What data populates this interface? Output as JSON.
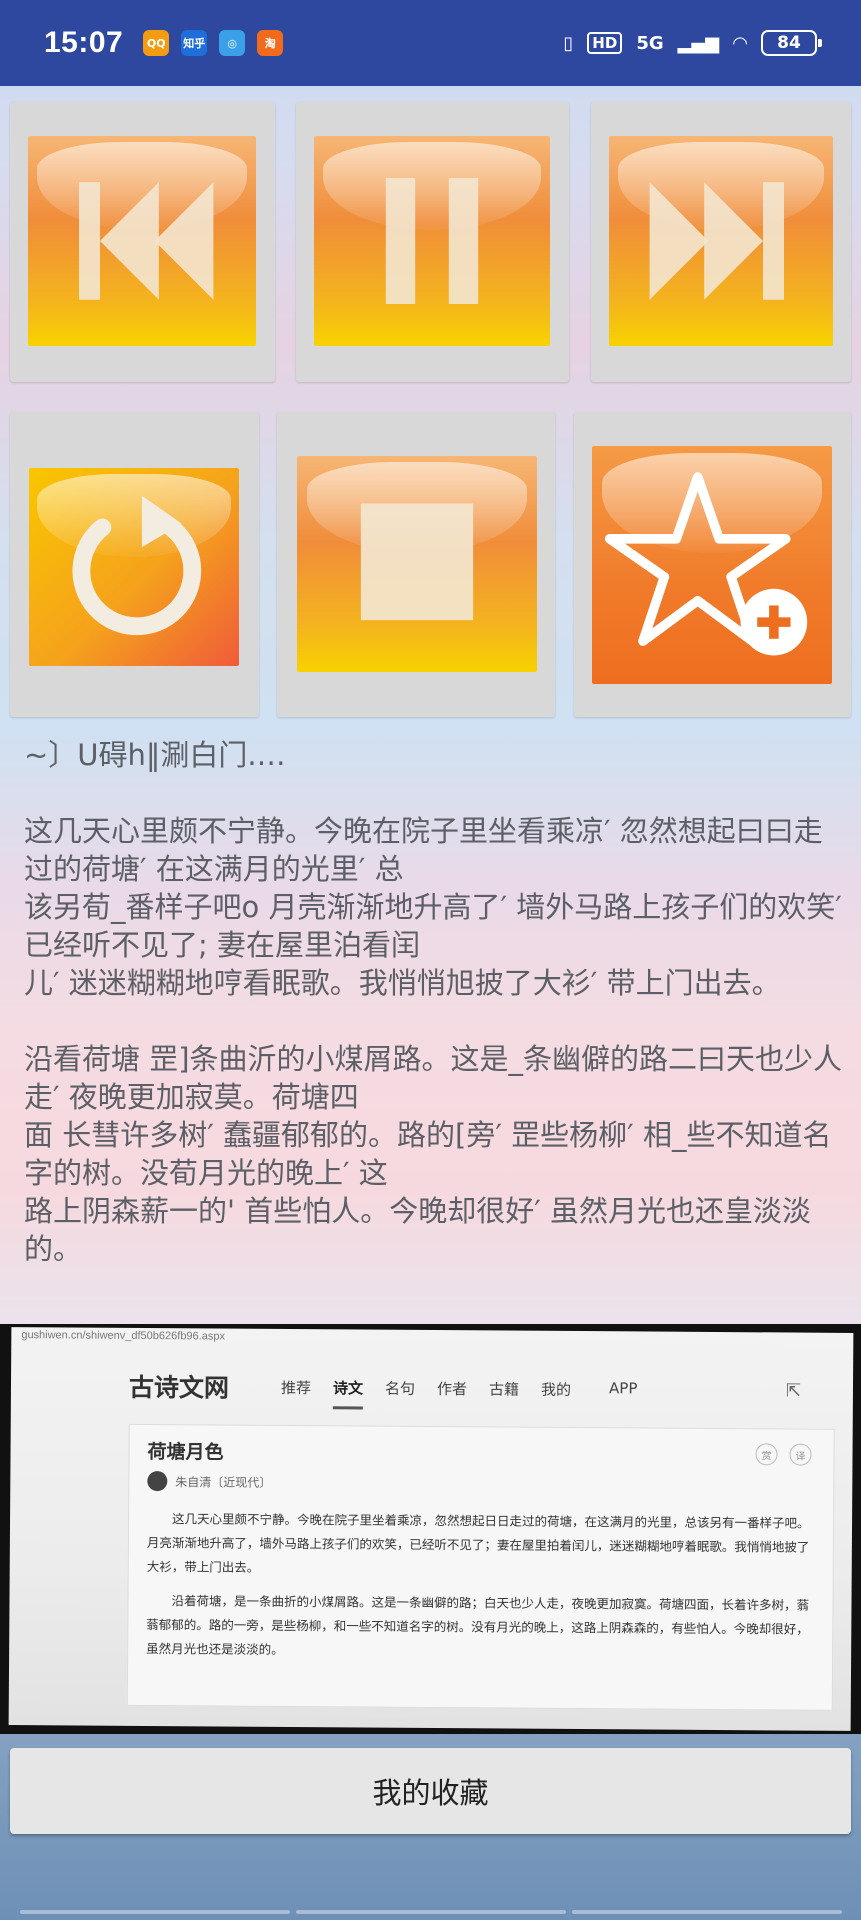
{
  "status_bar": {
    "time": "15:07",
    "notifications": [
      {
        "icon": "qq-icon",
        "label": "QQ",
        "color": "#f39c12"
      },
      {
        "icon": "zhihu-icon",
        "label": "知乎",
        "color": "#1e6fd9"
      },
      {
        "icon": "browser-icon",
        "label": "",
        "color": "#3aa0e8"
      },
      {
        "icon": "taobao-icon",
        "label": "淘",
        "color": "#f26b1d"
      }
    ],
    "hd_label": "HD",
    "network": "5G",
    "battery": "84"
  },
  "controls": [
    {
      "name": "previous-button",
      "icon": "previous-icon"
    },
    {
      "name": "pause-button",
      "icon": "pause-icon"
    },
    {
      "name": "next-button",
      "icon": "next-icon"
    },
    {
      "name": "replay-button",
      "icon": "replay-icon"
    },
    {
      "name": "stop-button",
      "icon": "stop-icon"
    },
    {
      "name": "add-favorite-button",
      "icon": "star-plus-icon"
    }
  ],
  "article": {
    "heading": "~〕U碍h‖涮白门.…",
    "paragraphs": [
      "这几天心里颇不宁静。今晚在院子里坐看乘凉′ 忽然想起曰曰走过的荷塘′ 在这满月的光里′ 总\n该另荀_番样子吧o 月壳渐渐地升高了′ 墙外马路上孩子们的欢笑′ 已经听不见了; 妻在屋里泊看闰\n儿′ 迷迷糊糊地哼看眠歌。我悄悄旭披了大衫′ 带上门出去。",
      "沿看荷塘 罡]条曲沂的小煤屑路。这是_条幽僻的路二曰天也少人走′ 夜晚更加寂莫。荷塘四\n面 长彗许多树′ 蠢疆郁郁的。路的[旁′ 罡些杨柳′ 相_些不知道名字的树。没荀月光的晚上′ 这\n路上阴森薪一的' 首些怕人。今晚却很好′ 虽然月光也还皇淡淡的。"
    ]
  },
  "photo": {
    "url": "gushiwen.cn/shiwenv_df50b626fb96.aspx",
    "site_name": "古诗文网",
    "nav": [
      "推荐",
      "诗文",
      "名句",
      "作者",
      "古籍",
      "我的",
      "APP"
    ],
    "active_nav": "诗文",
    "poem_title": "荷塘月色",
    "author": "朱自清〔近现代〕",
    "card_icons": [
      "赏",
      "译"
    ],
    "paragraphs": [
      "这几天心里颇不宁静。今晚在院子里坐着乘凉，忽然想起日日走过的荷塘，在这满月的光里，总该另有一番样子吧。月亮渐渐地升高了，墙外马路上孩子们的欢笑，已经听不见了；妻在屋里拍着闰儿，迷迷糊糊地哼着眠歌。我悄悄地披了大衫，带上门出去。",
      "沿着荷塘，是一条曲折的小煤屑路。这是一条幽僻的路；白天也少人走，夜晚更加寂寞。荷塘四面，长着许多树，蓊蓊郁郁的。路的一旁，是些杨柳，和一些不知道名字的树。没有月光的晚上，这路上阴森森的，有些怕人。今晚却很好，虽然月光也还是淡淡的。"
    ]
  },
  "favorites_button": {
    "label": "我的收藏"
  }
}
